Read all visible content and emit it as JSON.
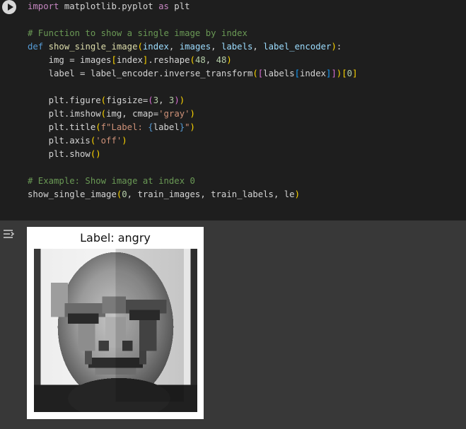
{
  "cell": {
    "run_button_label": "Run cell",
    "code_lines": [
      [
        {
          "t": "import",
          "c": "kw"
        },
        {
          "t": " matplotlib.pyplot ",
          "c": ""
        },
        {
          "t": "as",
          "c": "kw"
        },
        {
          "t": " plt",
          "c": ""
        }
      ],
      [],
      [
        {
          "t": "# Function to show a single image by index",
          "c": "cm"
        }
      ],
      [
        {
          "t": "def",
          "c": "def"
        },
        {
          "t": " ",
          "c": ""
        },
        {
          "t": "show_single_image",
          "c": "fn"
        },
        {
          "t": "(",
          "c": "p1"
        },
        {
          "t": "index",
          "c": "var"
        },
        {
          "t": ", ",
          "c": ""
        },
        {
          "t": "images",
          "c": "var"
        },
        {
          "t": ", ",
          "c": ""
        },
        {
          "t": "labels",
          "c": "var"
        },
        {
          "t": ", ",
          "c": ""
        },
        {
          "t": "label_encoder",
          "c": "var"
        },
        {
          "t": ")",
          "c": "p1"
        },
        {
          "t": ":",
          "c": ""
        }
      ],
      [
        {
          "t": "    img = images",
          "c": ""
        },
        {
          "t": "[",
          "c": "p1"
        },
        {
          "t": "index",
          "c": ""
        },
        {
          "t": "]",
          "c": "p1"
        },
        {
          "t": ".reshape",
          "c": ""
        },
        {
          "t": "(",
          "c": "p1"
        },
        {
          "t": "48",
          "c": "num"
        },
        {
          "t": ", ",
          "c": ""
        },
        {
          "t": "48",
          "c": "num"
        },
        {
          "t": ")",
          "c": "p1"
        }
      ],
      [
        {
          "t": "    label = label_encoder.inverse_transform",
          "c": ""
        },
        {
          "t": "(",
          "c": "p1"
        },
        {
          "t": "[",
          "c": "p2"
        },
        {
          "t": "labels",
          "c": ""
        },
        {
          "t": "[",
          "c": "p3"
        },
        {
          "t": "index",
          "c": ""
        },
        {
          "t": "]",
          "c": "p3"
        },
        {
          "t": "]",
          "c": "p2"
        },
        {
          "t": ")",
          "c": "p1"
        },
        {
          "t": "[",
          "c": "p1"
        },
        {
          "t": "0",
          "c": "num"
        },
        {
          "t": "]",
          "c": "p1"
        }
      ],
      [],
      [
        {
          "t": "    plt.figure",
          "c": ""
        },
        {
          "t": "(",
          "c": "p1"
        },
        {
          "t": "figsize=",
          "c": ""
        },
        {
          "t": "(",
          "c": "p2"
        },
        {
          "t": "3",
          "c": "num"
        },
        {
          "t": ", ",
          "c": ""
        },
        {
          "t": "3",
          "c": "num"
        },
        {
          "t": ")",
          "c": "p2"
        },
        {
          "t": ")",
          "c": "p1"
        }
      ],
      [
        {
          "t": "    plt.imshow",
          "c": ""
        },
        {
          "t": "(",
          "c": "p1"
        },
        {
          "t": "img, cmap=",
          "c": ""
        },
        {
          "t": "'gray'",
          "c": "str"
        },
        {
          "t": ")",
          "c": "p1"
        }
      ],
      [
        {
          "t": "    plt.title",
          "c": ""
        },
        {
          "t": "(",
          "c": "p1"
        },
        {
          "t": "f\"Label: ",
          "c": "str"
        },
        {
          "t": "{",
          "c": "def"
        },
        {
          "t": "label",
          "c": ""
        },
        {
          "t": "}",
          "c": "def"
        },
        {
          "t": "\"",
          "c": "str"
        },
        {
          "t": ")",
          "c": "p1"
        }
      ],
      [
        {
          "t": "    plt.axis",
          "c": ""
        },
        {
          "t": "(",
          "c": "p1"
        },
        {
          "t": "'off'",
          "c": "str"
        },
        {
          "t": ")",
          "c": "p1"
        }
      ],
      [
        {
          "t": "    plt.show",
          "c": ""
        },
        {
          "t": "()",
          "c": "p1"
        }
      ],
      [],
      [
        {
          "t": "# Example: Show image at index 0",
          "c": "cm"
        }
      ],
      [
        {
          "t": "show_single_image",
          "c": ""
        },
        {
          "t": "(",
          "c": "p1"
        },
        {
          "t": "0",
          "c": "num"
        },
        {
          "t": ", train_images, train_labels, le",
          "c": ""
        },
        {
          "t": ")",
          "c": "p1"
        }
      ]
    ]
  },
  "output": {
    "figure_title": "Label: angry",
    "image_icon": "grayscale-face-image",
    "output_toggle_icon": "output-collapse-icon"
  }
}
